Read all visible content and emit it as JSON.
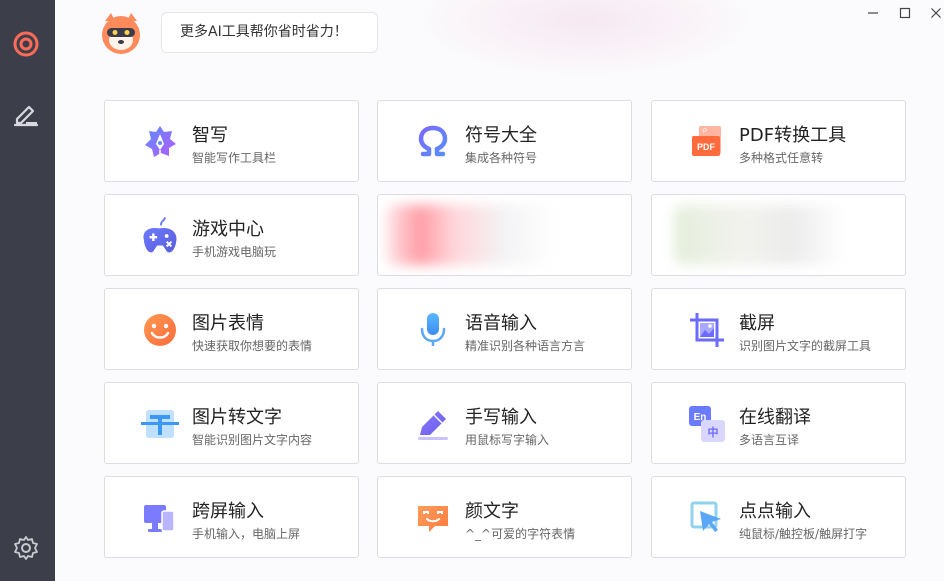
{
  "header": {
    "bubble_text": "更多AI工具帮你省时省力！"
  },
  "window_controls": {
    "minimize": "—",
    "maximize": "☐",
    "close": "✕"
  },
  "colors": {
    "sidebar_bg": "#3c3f4a",
    "accent": "#ff6b57"
  },
  "sidebar": {
    "items": [
      {
        "icon": "target-icon"
      },
      {
        "icon": "pen-edit-icon"
      },
      {
        "icon": "gear-icon"
      }
    ]
  },
  "tools": [
    {
      "title": "智写",
      "subtitle": "智能写作工具栏",
      "icon": "smart-write-icon"
    },
    {
      "title": "符号大全",
      "subtitle": "集成各种符号",
      "icon": "omega-icon"
    },
    {
      "title": "PDF转换工具",
      "subtitle": "多种格式任意转",
      "icon": "pdf-icon"
    },
    {
      "title": "游戏中心",
      "subtitle": "手机游戏电脑玩",
      "icon": "gamepad-icon"
    },
    {
      "title": "",
      "subtitle": "",
      "icon": "blurred-ad"
    },
    {
      "title": "",
      "subtitle": "",
      "icon": "blurred-ad"
    },
    {
      "title": "图片表情",
      "subtitle": "快速获取你想要的表情",
      "icon": "smiley-icon"
    },
    {
      "title": "语音输入",
      "subtitle": "精准识别各种语言方言",
      "icon": "microphone-icon"
    },
    {
      "title": "截屏",
      "subtitle": "识别图片文字的截屏工具",
      "icon": "screenshot-icon"
    },
    {
      "title": "图片转文字",
      "subtitle": "智能识别图片文字内容",
      "icon": "ocr-icon"
    },
    {
      "title": "手写输入",
      "subtitle": "用鼠标写字输入",
      "icon": "handwriting-pen-icon"
    },
    {
      "title": "在线翻译",
      "subtitle": "多语言互译",
      "icon": "translate-icon"
    },
    {
      "title": "跨屏输入",
      "subtitle": "手机输入，电脑上屏",
      "icon": "cross-screen-icon"
    },
    {
      "title": "颜文字",
      "subtitle": "^_^可爱的字符表情",
      "icon": "kaomoji-icon"
    },
    {
      "title": "点点输入",
      "subtitle": "纯鼠标/触控板/触屏打字",
      "icon": "pointer-click-icon"
    }
  ]
}
